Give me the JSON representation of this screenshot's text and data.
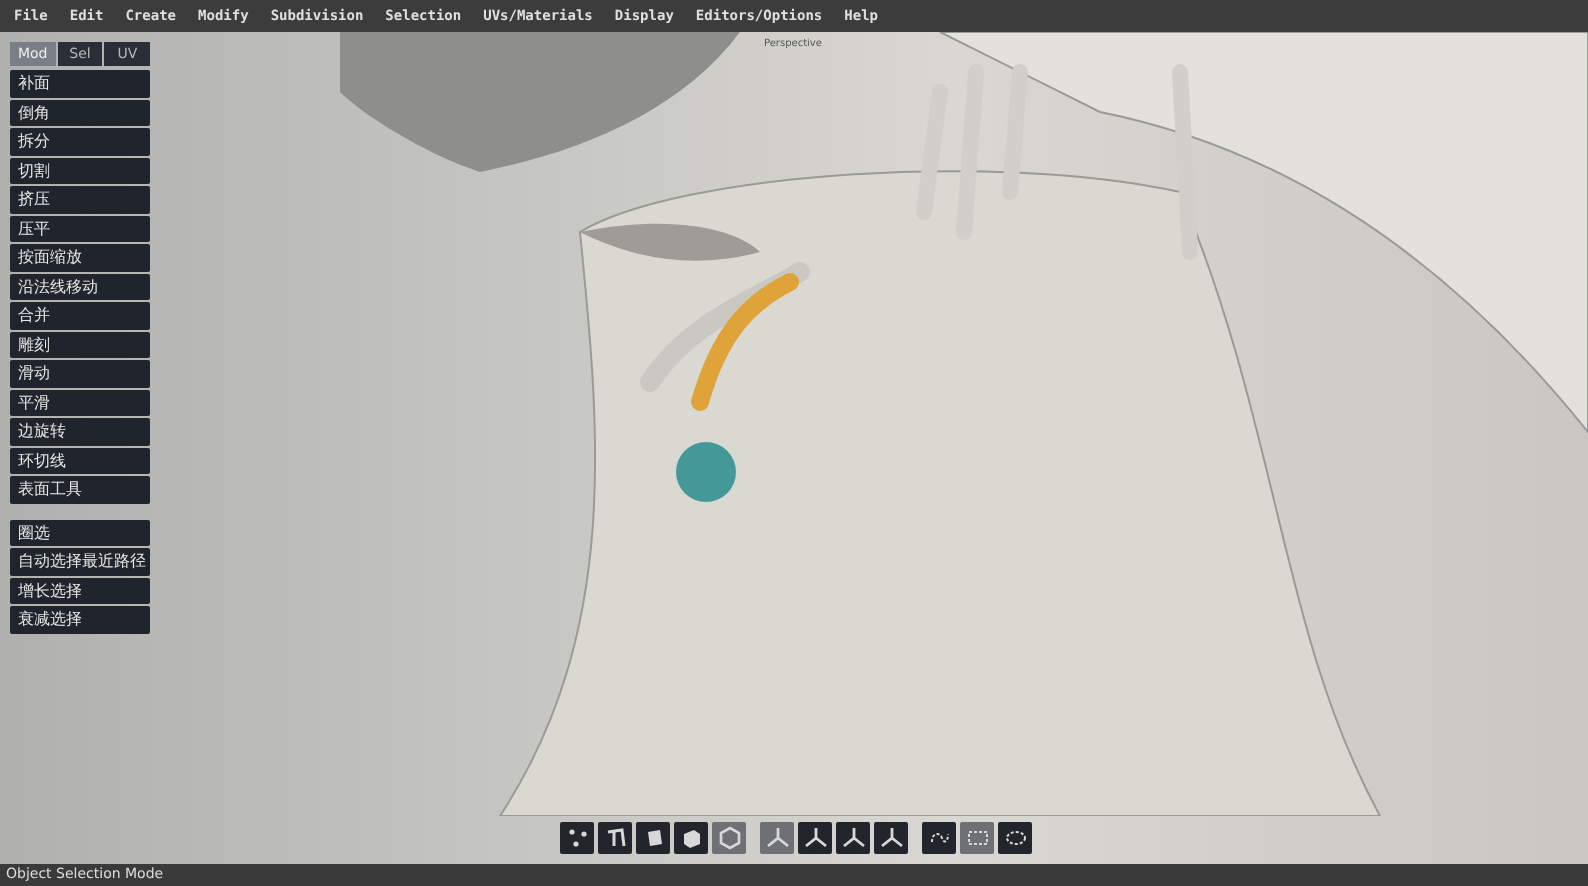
{
  "menu_bar": [
    "File",
    "Edit",
    "Create",
    "Modify",
    "Subdivision",
    "Selection",
    "UVs/Materials",
    "Display",
    "Editors/Options",
    "Help"
  ],
  "viewport": {
    "label": "Perspective"
  },
  "panel_tabs": [
    {
      "label": "Mod",
      "selected": true
    },
    {
      "label": "Sel",
      "selected": false
    },
    {
      "label": "UV",
      "selected": false
    }
  ],
  "tools": [
    "补面",
    "倒角",
    "拆分",
    "切割",
    "挤压",
    "压平",
    "按面缩放",
    "沿法线移动",
    "合并",
    "雕刻",
    "滑动",
    "平滑",
    "边旋转",
    "环切线",
    "表面工具"
  ],
  "selection_tools": [
    "圈选",
    "自动选择最近路径",
    "增长选择",
    "衰减选择"
  ],
  "toolbar": [
    {
      "kind": "points",
      "selected": false
    },
    {
      "kind": "edges",
      "selected": false
    },
    {
      "kind": "faces",
      "selected": false
    },
    {
      "kind": "objects",
      "selected": false
    },
    {
      "kind": "hexagon",
      "selected": true
    },
    {
      "kind": "axis",
      "selected": true
    },
    {
      "kind": "axis",
      "selected": false
    },
    {
      "kind": "axis",
      "selected": false
    },
    {
      "kind": "axis",
      "selected": false
    },
    {
      "kind": "lasso",
      "selected": false
    },
    {
      "kind": "rect",
      "selected": true
    },
    {
      "kind": "paint",
      "selected": false
    }
  ],
  "status_bar": "Object Selection Mode"
}
